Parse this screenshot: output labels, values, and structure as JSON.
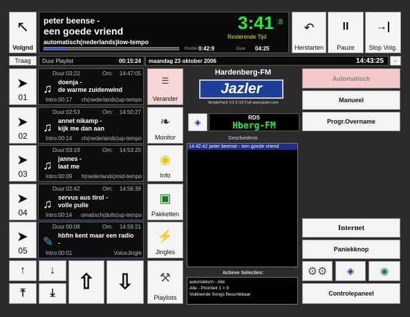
{
  "top": {
    "volgnd_label": "Volgnd",
    "artist_line": "peter beense -",
    "title_line": "een goede vriend",
    "category": "automatisch(nederlands)low-tempo",
    "clock": "3:41",
    "clock_sub": ":8",
    "remaining_label": "Resterende Tijd",
    "positie_label": "Positie",
    "positie_value": "0:42:9",
    "duur_label": "Duur",
    "duur_value": "04:25",
    "progress": 0.16,
    "herstarten_label": "Herstarten",
    "pauze_label": "Pauze",
    "stop_label": "Stop Volg."
  },
  "bar": {
    "traag_label": "Traag",
    "playlist_label": "Duur Playlist",
    "playlist_value": "00:15:24",
    "date": "maandag 23 oktober 2006",
    "time": "14:43:25",
    "minus_label": "-"
  },
  "songs": [
    {
      "num": "01",
      "duur": "Duur:03:22",
      "om": "Om:",
      "time": "14:47:05",
      "artist": "doenja -",
      "title": "de warme zuidenwind",
      "intro": "Intro:00:17",
      "cat": "ch(nederlands)up-tempo"
    },
    {
      "num": "02",
      "duur": "Duur:02:53",
      "om": "Om:",
      "time": "14:50:27",
      "artist": "annet nikamp -",
      "title": "kijk me dan aan",
      "intro": "Intro:00:14",
      "cat": "ch(nederlands)up-tempo"
    },
    {
      "num": "03",
      "duur": "Duur:03:19",
      "om": "Om:",
      "time": "14:53:20",
      "artist": "jannes -",
      "title": "laat me",
      "intro": "Intro:00:09",
      "cat": "h(nederlands)mid-tempo"
    },
    {
      "num": "04",
      "duur": "Duur:02:42",
      "om": "Om:",
      "time": "14:56:39",
      "artist": "servus aus tirol -",
      "title": "volle pulle",
      "intro": "Intro:00:14",
      "cat": "omatisch(duits)up-tempo"
    },
    {
      "num": "05",
      "duur": "Duur:00:08",
      "om": "Om:",
      "time": "14:59:21",
      "artist": "hbfm kent maar een radio",
      "title": "-",
      "intro": "Intro:00:01",
      "cat": "VoiceJingle"
    }
  ],
  "mid": {
    "verander": "Verander",
    "monitor": "Monitor",
    "info": "Info",
    "pakketten": "Pakketten",
    "jingles": "Jingles",
    "playlists": "Playlists"
  },
  "center": {
    "station": "Hardenberg-FM",
    "logo": "Jazler",
    "version": "SimplePack V.2.3 r22 Full  www.jazler.com",
    "rds_label": "RDS",
    "rds_value": "Hberg-FM",
    "geschiedenis_label": "Geschiedenis",
    "history": [
      "14:42:42 peter beense  - een goede vriend"
    ],
    "actieve_label": "Actieve Selecties:",
    "actieve": [
      "automatisch - Alle",
      "Alle - Prioriteit 1 > 9",
      "Voldoende Songs Beschikbaar"
    ]
  },
  "right": {
    "automatisch": "Automatisch",
    "manueel": "Manueel",
    "progr": "Progr.Overname",
    "internet": "Internet",
    "paniek": "Paniekknop",
    "control": "Controlepaneel"
  },
  "colors": {
    "clock_green": "#22ee33",
    "automatisch_bg": "#f4c8c8",
    "rds_green": "#22ee33",
    "history_sel": "#1c2f8a"
  }
}
